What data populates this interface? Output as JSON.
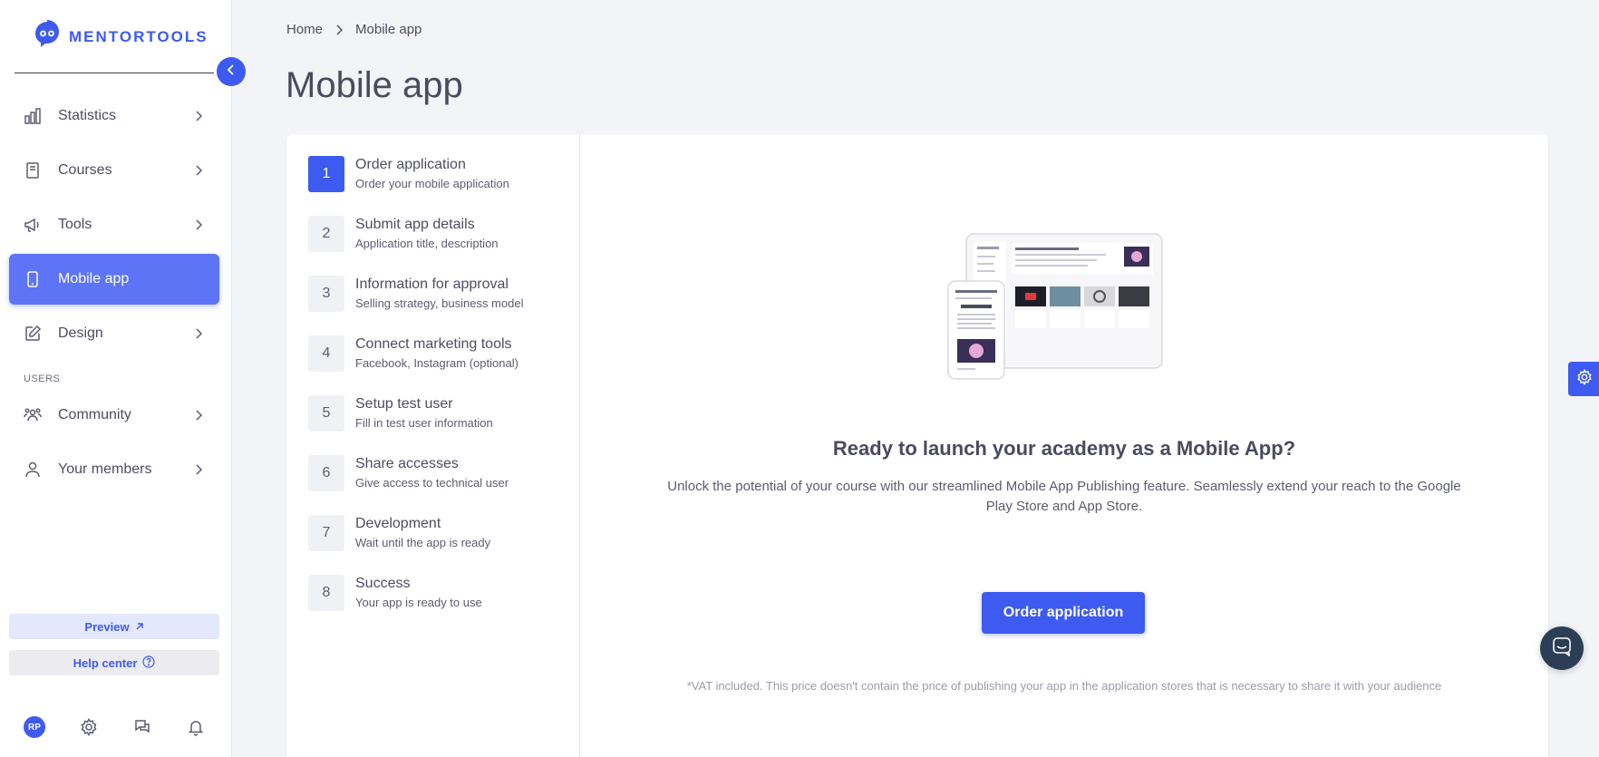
{
  "brand": {
    "name": "MENTORTOOLS",
    "accent": "#3d5af1"
  },
  "sidebar": {
    "items": [
      {
        "label": "Statistics",
        "icon": "bar-chart-icon"
      },
      {
        "label": "Courses",
        "icon": "book-icon"
      },
      {
        "label": "Tools",
        "icon": "megaphone-icon"
      },
      {
        "label": "Mobile app",
        "icon": "phone-icon",
        "active": true
      },
      {
        "label": "Design",
        "icon": "pencil-icon"
      }
    ],
    "users_section": "USERS",
    "user_items": [
      {
        "label": "Community",
        "icon": "group-icon"
      },
      {
        "label": "Your members",
        "icon": "person-icon"
      }
    ],
    "preview_label": "Preview",
    "help_label": "Help center",
    "avatar_initials": "RP"
  },
  "breadcrumb": {
    "home": "Home",
    "current": "Mobile app"
  },
  "page": {
    "title": "Mobile app"
  },
  "steps": [
    {
      "num": "1",
      "title": "Order application",
      "sub": "Order your mobile application"
    },
    {
      "num": "2",
      "title": "Submit app details",
      "sub": "Application title, description"
    },
    {
      "num": "3",
      "title": "Information for approval",
      "sub": "Selling strategy, business model"
    },
    {
      "num": "4",
      "title": "Connect marketing tools",
      "sub": "Facebook, Instagram (optional)"
    },
    {
      "num": "5",
      "title": "Setup test user",
      "sub": "Fill in test user information"
    },
    {
      "num": "6",
      "title": "Share accesses",
      "sub": "Give access to technical user"
    },
    {
      "num": "7",
      "title": "Development",
      "sub": "Wait until the app is ready"
    },
    {
      "num": "8",
      "title": "Success",
      "sub": "Your app is ready to use"
    }
  ],
  "main": {
    "headline": "Ready to launch your academy as a Mobile App?",
    "description": "Unlock the potential of your course with our streamlined Mobile App Publishing feature. Seamlessly extend your reach to the Google Play Store and App Store.",
    "order_button": "Order application",
    "vat_note": "*VAT included. This price doesn't contain the price of publishing your app in the application stores that is necessary to share it with your audience"
  }
}
